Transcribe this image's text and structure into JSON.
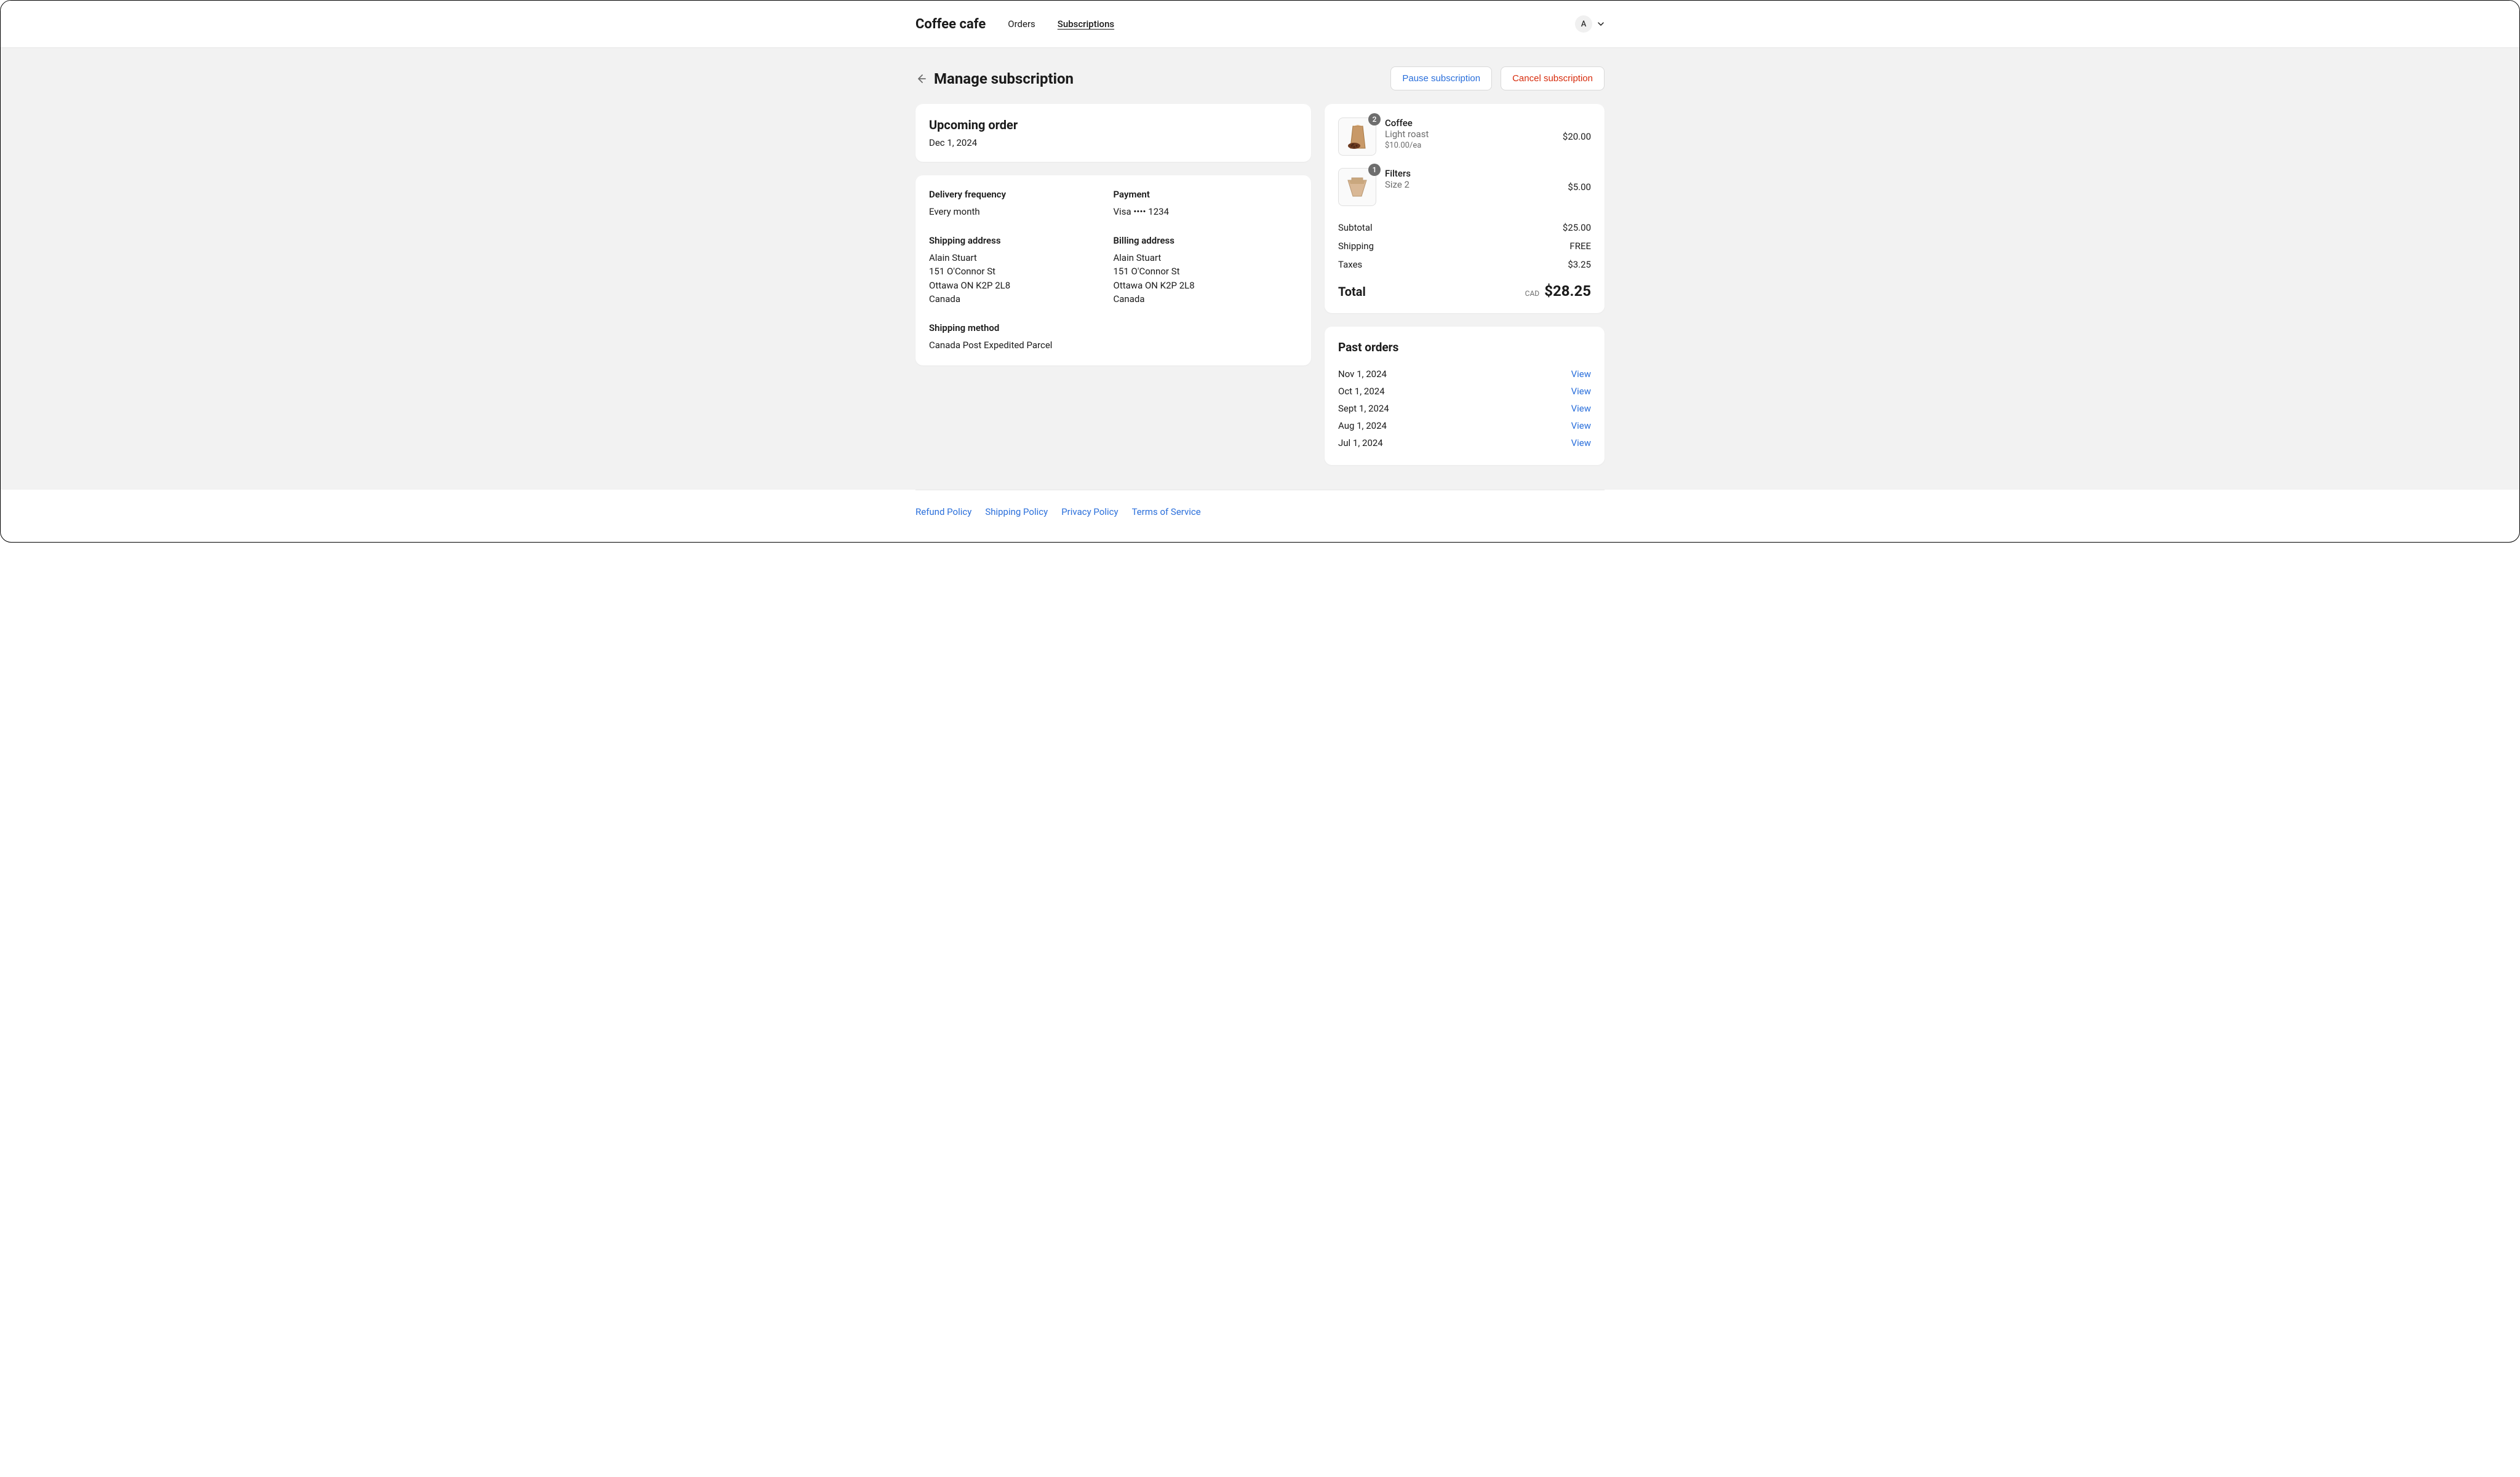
{
  "header": {
    "brand": "Coffee cafe",
    "nav": {
      "orders": "Orders",
      "subscriptions": "Subscriptions"
    },
    "avatar_initial": "A"
  },
  "page": {
    "title": "Manage subscription",
    "pause_label": "Pause subscription",
    "cancel_label": "Cancel subscription"
  },
  "upcoming": {
    "title": "Upcoming order",
    "date": "Dec 1, 2024"
  },
  "details": {
    "frequency_label": "Delivery frequency",
    "frequency_value": "Every month",
    "payment_label": "Payment",
    "payment_value": "Visa •••• 1234",
    "shipping_addr_label": "Shipping address",
    "shipping_addr": {
      "name": "Alain Stuart",
      "line1": "151 O'Connor St",
      "line2": "Ottawa ON K2P 2L8",
      "country": "Canada"
    },
    "billing_addr_label": "Billing address",
    "billing_addr": {
      "name": "Alain Stuart",
      "line1": "151 O'Connor St",
      "line2": "Ottawa ON K2P 2L8",
      "country": "Canada"
    },
    "shipping_method_label": "Shipping method",
    "shipping_method_value": "Canada Post Expedited Parcel"
  },
  "items": [
    {
      "qty": "2",
      "name": "Coffee",
      "variant": "Light roast",
      "unit_price": "$10.00/ea",
      "line_price": "$20.00"
    },
    {
      "qty": "1",
      "name": "Filters",
      "variant": "Size 2",
      "unit_price": "",
      "line_price": "$5.00"
    }
  ],
  "summary": {
    "subtotal_label": "Subtotal",
    "subtotal_value": "$25.00",
    "shipping_label": "Shipping",
    "shipping_value": "FREE",
    "taxes_label": "Taxes",
    "taxes_value": "$3.25",
    "total_label": "Total",
    "currency": "CAD",
    "total_value": "$28.25"
  },
  "past_orders": {
    "title": "Past orders",
    "view_label": "View",
    "rows": [
      "Nov 1, 2024",
      "Oct 1, 2024",
      "Sept 1, 2024",
      "Aug 1, 2024",
      "Jul 1, 2024"
    ]
  },
  "footer": {
    "refund": "Refund Policy",
    "shipping": "Shipping Policy",
    "privacy": "Privacy Policy",
    "terms": "Terms of Service"
  }
}
